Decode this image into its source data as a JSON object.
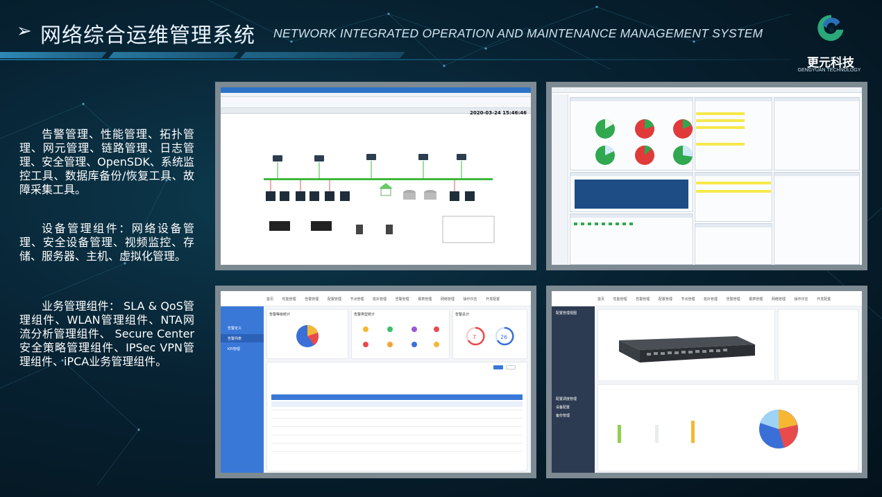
{
  "header": {
    "arrow": "➢",
    "title_cn": "网络综合运维管理系统",
    "title_en": "NETWORK INTEGRATED OPERATION AND MAINTENANCE MANAGEMENT SYSTEM"
  },
  "logo": {
    "name_cn": "更元科技",
    "name_en": "GENGYUAN TECHNOLOGY",
    "colors": {
      "green": "#2aa87a",
      "blue": "#2a6fb8"
    }
  },
  "descriptions": [
    "告警管理、性能管理、拓扑管理、网元管理、链路管理、日志管理、安全管理、OpenSDK、系统监控工具、数据库备份/恢复工具、故障采集工具。",
    "设备管理组件：网络设备管理、安全设备管理、视频监控、存储、服务器、主机、虚拟化管理。",
    "业务管理组件： SLA & QoS管理组件、WLAN管理组件、NTA网流分析管理组件、 Secure Center安全策略管理组件、IPSec VPN管理组件、iPCA业务管理组件。"
  ],
  "panels": {
    "topology": {
      "date": "2020-03-24 15:46:46"
    },
    "web_alarm": {
      "tabs": [
        "首页",
        "性能管理",
        "告警管理",
        "配置管理",
        "节点管理",
        "拓扑管理",
        "告警管理",
        "报表管理",
        "网络管理",
        "操作日志",
        "开发配置"
      ],
      "side": [
        "告警定义",
        "告警列表",
        "KPI管理"
      ],
      "card_titles": [
        "告警等级统计",
        "告警类型统计",
        "告警总计"
      ],
      "totals": [
        "7",
        "26"
      ]
    },
    "web_device": {
      "tabs": [
        "首页",
        "性能管理",
        "告警管理",
        "配置管理",
        "节点管理",
        "拓扑管理",
        "告警管理",
        "报表管理",
        "网络管理",
        "操作日志",
        "开发配置"
      ],
      "side": [
        "配置管理视图",
        "配置调度管理",
        "设备配置",
        "备份管理"
      ]
    },
    "colors": {
      "frame": "#7d8a92",
      "accent": "#3a78d8",
      "critical": "#e03a3a",
      "ok": "#2fa84f"
    }
  }
}
